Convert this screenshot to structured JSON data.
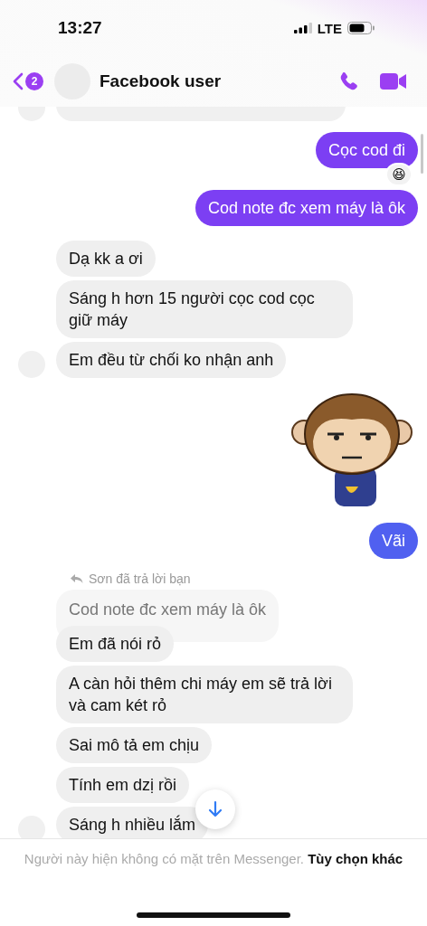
{
  "status_bar": {
    "time": "13:27",
    "network": "LTE"
  },
  "header": {
    "unread_count": "2",
    "name": "Facebook user"
  },
  "messages": [
    {
      "kind": "outgoing",
      "text": "Cọc cod đi",
      "reaction": "😆"
    },
    {
      "kind": "outgoing",
      "text": "Cod note đc xem máy là ôk"
    },
    {
      "kind": "incoming",
      "text": "Dạ kk a ơi",
      "avatar": false
    },
    {
      "kind": "incoming",
      "text": "Sáng h hơn 15 người cọc cod cọc giữ máy",
      "avatar": false
    },
    {
      "kind": "incoming",
      "text": "Em đều từ chối ko nhận anh",
      "avatar": true
    },
    {
      "kind": "sticker"
    },
    {
      "kind": "outgoing",
      "text": "Vãi"
    },
    {
      "kind": "reply",
      "label": "Sơn đã trả lời bạn",
      "quote": "Cod note đc xem máy là ôk"
    },
    {
      "kind": "incoming",
      "text": "Em đã nói rỏ",
      "avatar": false
    },
    {
      "kind": "incoming",
      "text": "A càn hỏi thêm chi máy em sẽ trả lời và cam két rỏ",
      "avatar": false
    },
    {
      "kind": "incoming",
      "text": "Sai mô tả em chịu",
      "avatar": false
    },
    {
      "kind": "incoming",
      "text": "Tính em dzị rồi",
      "avatar": false
    },
    {
      "kind": "incoming",
      "text": "Sáng h nhiều lắm",
      "avatar": true
    }
  ],
  "footer": {
    "notice": "Người này hiện không có mặt trên Messenger.",
    "link": "Tùy chọn khác"
  }
}
